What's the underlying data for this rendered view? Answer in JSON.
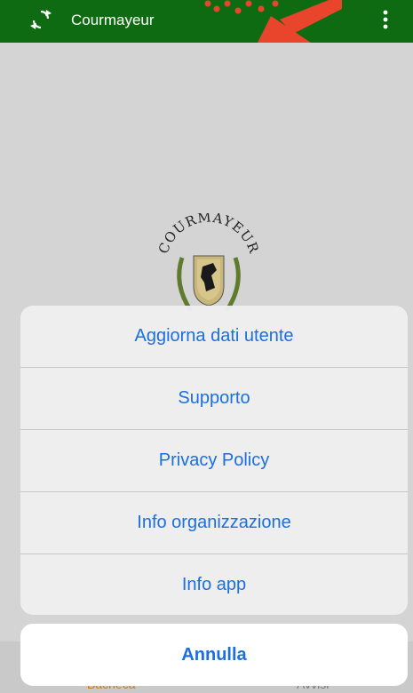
{
  "header": {
    "title": "Courmayeur",
    "refresh_icon": "refresh-icon",
    "more_icon": "more-vertical-icon",
    "background_color": "#0f6b12"
  },
  "emblem": {
    "text": "COURMAYEUR"
  },
  "tabs": [
    {
      "label": "Bacheca",
      "color": "#c07a2a"
    },
    {
      "label": "Avvisi",
      "color": "#7b7b7b"
    }
  ],
  "action_sheet": {
    "items": [
      {
        "label": "Aggiorna dati utente"
      },
      {
        "label": "Supporto"
      },
      {
        "label": "Privacy Policy"
      },
      {
        "label": "Info organizzazione"
      },
      {
        "label": "Info app"
      }
    ],
    "cancel_label": "Annulla",
    "accent_color": "#1b6fe0"
  }
}
